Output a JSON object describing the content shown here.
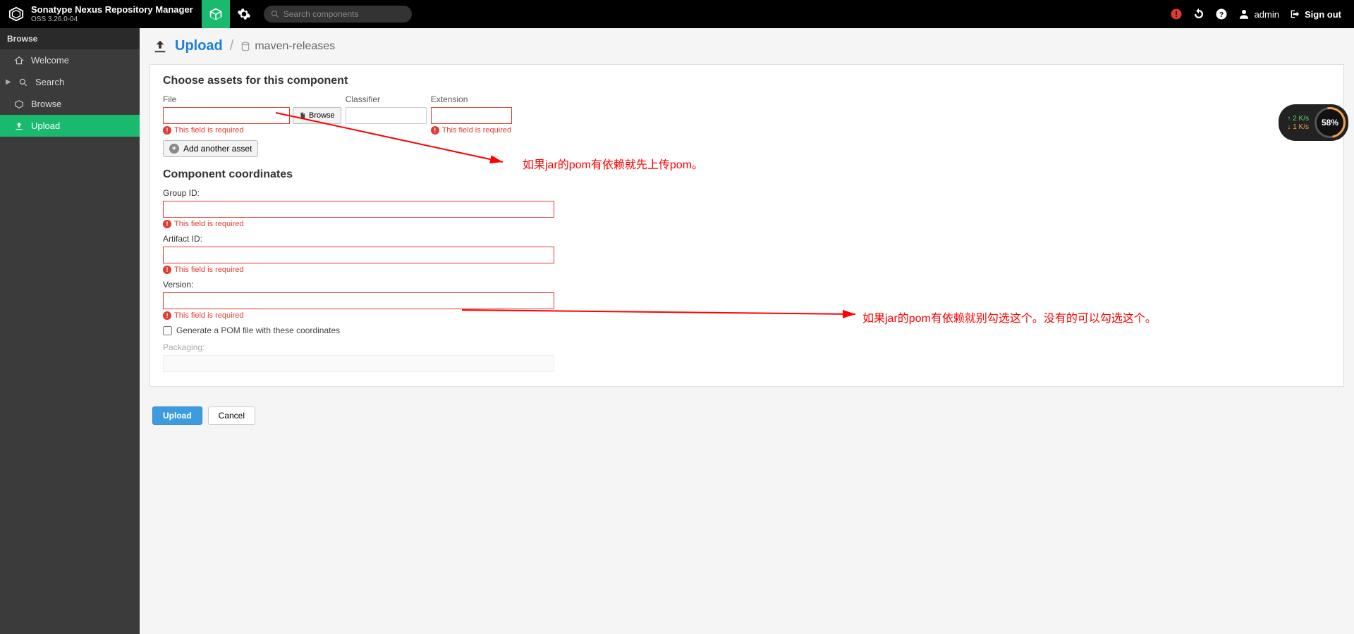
{
  "header": {
    "brand_title": "Sonatype Nexus Repository Manager",
    "brand_version": "OSS 3.26.0-04",
    "search_placeholder": "Search components",
    "user_label": "admin",
    "signout_label": "Sign out"
  },
  "sidebar": {
    "header": "Browse",
    "items": [
      {
        "label": "Welcome",
        "icon": "home"
      },
      {
        "label": "Search",
        "icon": "search",
        "has_caret": true
      },
      {
        "label": "Browse",
        "icon": "cube"
      },
      {
        "label": "Upload",
        "icon": "upload",
        "active": true
      }
    ]
  },
  "page": {
    "title": "Upload",
    "repo": "maven-releases"
  },
  "assets": {
    "section_title": "Choose assets for this component",
    "file_label": "File",
    "classifier_label": "Classifier",
    "extension_label": "Extension",
    "browse_btn": "Browse",
    "required_error": "This field is required",
    "add_asset_btn": "Add another asset"
  },
  "coords": {
    "section_title": "Component coordinates",
    "group_label": "Group ID:",
    "artifact_label": "Artifact ID:",
    "version_label": "Version:",
    "generate_pom_label": "Generate a POM file with these coordinates",
    "packaging_label": "Packaging:"
  },
  "buttons": {
    "upload": "Upload",
    "cancel": "Cancel"
  },
  "annotations": {
    "a1": "如果jar的pom有依赖就先上传pom。",
    "a2": "如果jar的pom有依赖就别勾选这个。没有的可以勾选这个。"
  },
  "widget": {
    "up": "2  K/s",
    "down": "1  K/s",
    "gauge": "58%"
  }
}
